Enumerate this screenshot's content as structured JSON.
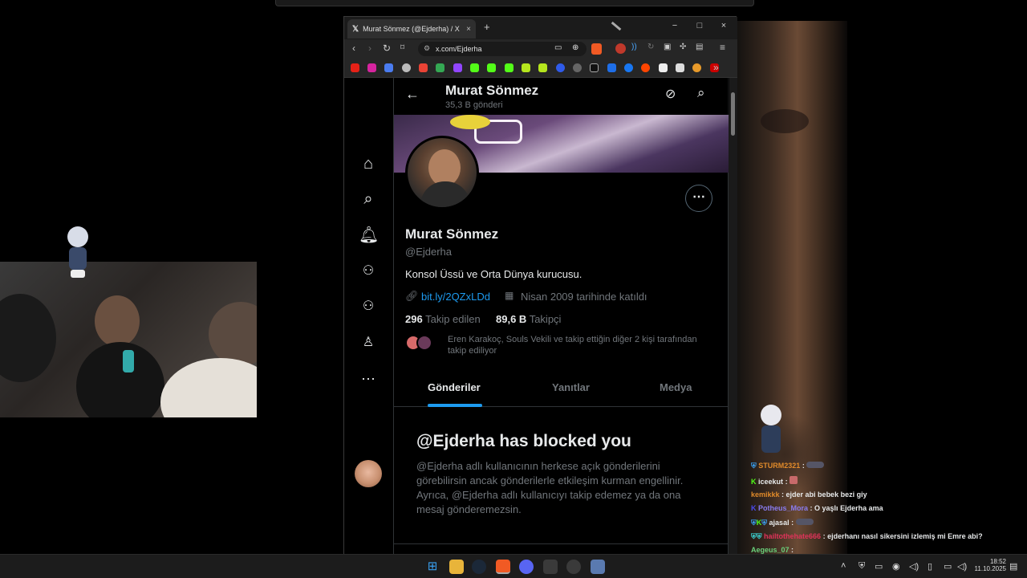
{
  "browser": {
    "tab_title": "Murat Sönmez (@Ejderha) / X",
    "tab_close": "×",
    "new_tab": "+",
    "url": "x.com/Ejderha",
    "window_minimize": "−",
    "window_maximize": "□",
    "window_close": "×",
    "more_bookmarks": "»"
  },
  "profile": {
    "header_name": "Murat Sönmez",
    "header_posts": "35,3 B gönderi",
    "name": "Murat Sönmez",
    "handle": "@Ejderha",
    "bio": "Konsol Üssü ve Orta Dünya kurucusu.",
    "link": "bit.ly/2QZxLDd",
    "joined": "Nisan 2009 tarihinde katıldı",
    "following_count": "296",
    "following_label": "Takip edilen",
    "followers_count": "89,6 B",
    "followers_label": "Takipçi",
    "followed_by_line1": "Eren Karakoç, Souls Vekili ve takip ettiğin diğer 2 kişi tarafından",
    "followed_by_line2": "takip ediliyor",
    "tabs": [
      "Gönderiler",
      "Yanıtlar",
      "Medya"
    ],
    "blocked_title": "@Ejderha has blocked you",
    "blocked_body": [
      "@Ejderha adlı kullanıcının herkese açık gönderilerini",
      "görebilirsin ancak gönderilerle etkileşim kurman engellinir.",
      "Ayrıca, @Ejderha adlı kullanıcıyı takip edemez ya da ona",
      "mesaj gönderemezsin."
    ]
  },
  "chat": [
    {
      "user": "STURM2321",
      "msg": ":",
      "color": "#e08a2a"
    },
    {
      "user": "iceekut",
      "msg": ":",
      "color": "#e7e9ea"
    },
    {
      "user": "kemikkk",
      "msg": ": ejder abi bebek bezi giy",
      "color": "#e08a2a"
    },
    {
      "user": "Potheus_Mora",
      "msg": ": O yaşlı Ejderha ama",
      "color": "#8a7cf0"
    },
    {
      "user": "ajasal",
      "msg": ":",
      "color": "#e7e9ea"
    },
    {
      "user": "hailtothehate666",
      "msg": ": ejderhanı nasıl sikersini izlemiş mi Emre abi?",
      "color": "#e0335a"
    },
    {
      "user": "Aegeus_07",
      "msg": ":",
      "color": "#6ad07a"
    }
  ],
  "taskbar": {
    "time": "18:52",
    "date": "11.10.2025"
  },
  "colors": {
    "accent": "#1d9bf0",
    "bg": "#000000",
    "muted": "#71767b"
  }
}
